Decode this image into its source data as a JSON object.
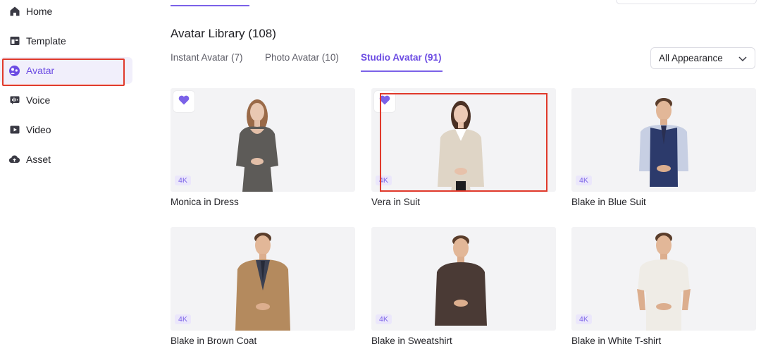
{
  "sidebar": {
    "items": [
      {
        "label": "Home",
        "icon": "home-icon",
        "active": false
      },
      {
        "label": "Template",
        "icon": "template-icon",
        "active": false
      },
      {
        "label": "Avatar",
        "icon": "avatar-icon",
        "active": true
      },
      {
        "label": "Voice",
        "icon": "voice-icon",
        "active": false
      },
      {
        "label": "Video",
        "icon": "video-icon",
        "active": false
      },
      {
        "label": "Asset",
        "icon": "cloud-upload-icon",
        "active": false
      }
    ]
  },
  "main": {
    "title": "Avatar Library (108)",
    "tabs": [
      {
        "label": "Instant Avatar (7)",
        "active": false
      },
      {
        "label": "Photo Avatar (10)",
        "active": false
      },
      {
        "label": "Studio Avatar (91)",
        "active": true
      }
    ],
    "filter": {
      "selected": "All Appearance"
    },
    "avatars": [
      {
        "name": "Monica in Dress",
        "badge": "4K",
        "favorited": true
      },
      {
        "name": "Vera in Suit",
        "badge": "4K",
        "favorited": true
      },
      {
        "name": "Blake in Blue Suit",
        "badge": "4K",
        "favorited": false
      },
      {
        "name": "Blake in Brown Coat",
        "badge": "4K",
        "favorited": false
      },
      {
        "name": "Blake in Sweatshirt",
        "badge": "4K",
        "favorited": false
      },
      {
        "name": "Blake in White T-shirt",
        "badge": "4K",
        "favorited": false
      }
    ]
  },
  "colors": {
    "accent": "#7b62e8",
    "highlight_box": "#e0392b",
    "card_bg": "#f3f3f5"
  }
}
